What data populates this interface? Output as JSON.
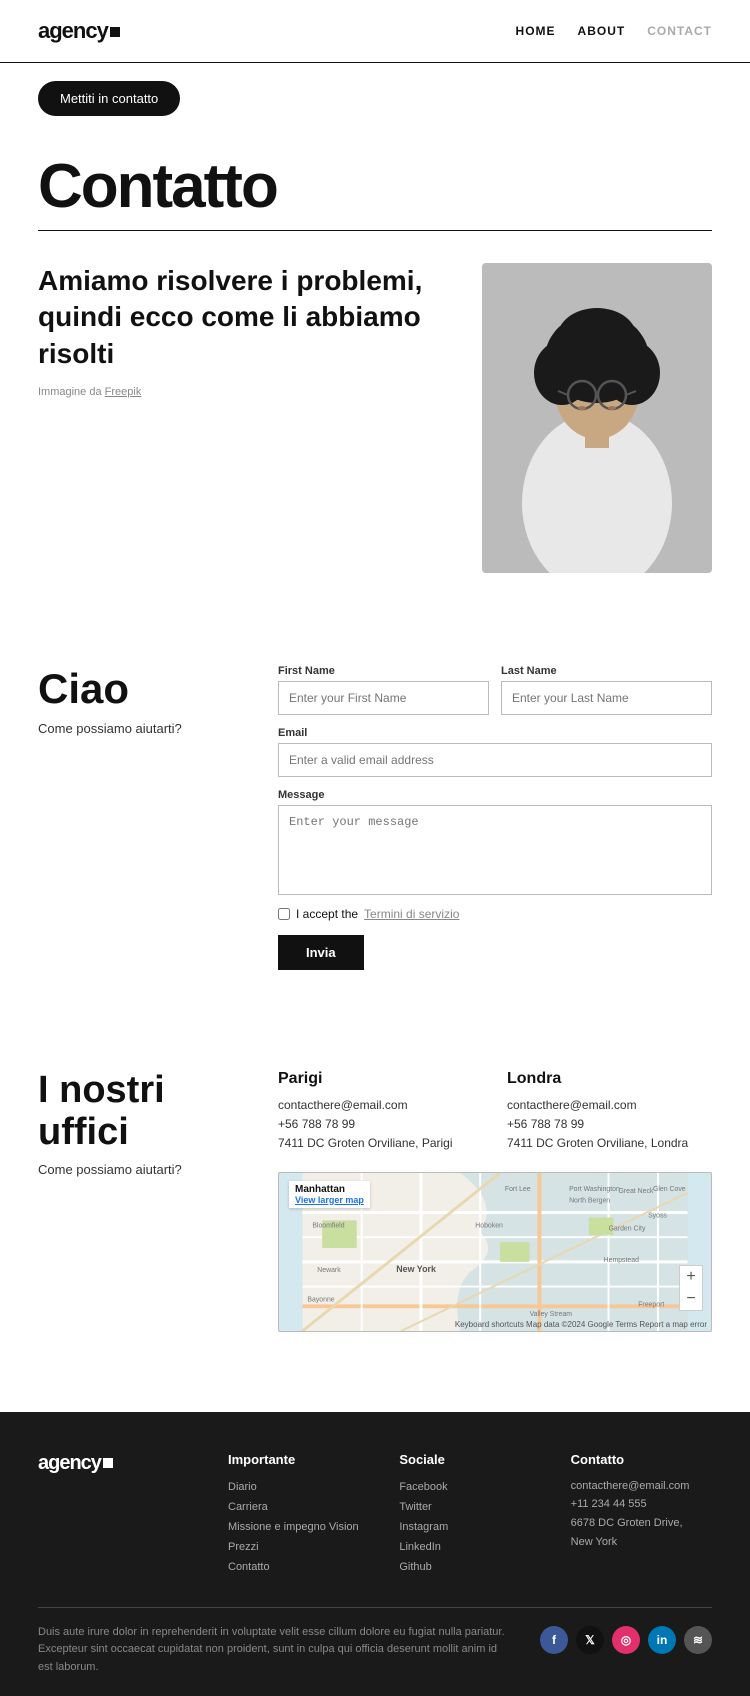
{
  "nav": {
    "logo": "agency",
    "links": [
      {
        "label": "HOME",
        "href": "#",
        "active": false
      },
      {
        "label": "ABOUT",
        "href": "#",
        "active": false
      },
      {
        "label": "CONTACT",
        "href": "#",
        "active": true
      }
    ]
  },
  "hero": {
    "cta_label": "Mettiti in contatto"
  },
  "contatto": {
    "heading": "Contatto"
  },
  "intro": {
    "heading": "Amiamo risolvere i problemi, quindi ecco come li abbiamo risolti",
    "image_credit": "Immagine da",
    "image_credit_link": "Freepik"
  },
  "form_section": {
    "left_heading": "Ciao",
    "left_sub": "Come possiamo aiutarti?",
    "first_name_label": "First Name",
    "first_name_placeholder": "Enter your First Name",
    "last_name_label": "Last Name",
    "last_name_placeholder": "Enter your Last Name",
    "email_label": "Email",
    "email_placeholder": "Enter a valid email address",
    "message_label": "Message",
    "message_placeholder": "Enter your message",
    "checkbox_text": "I accept the",
    "terms_link": "Termini di servizio",
    "submit_label": "Invia"
  },
  "uffici_section": {
    "left_heading": "I nostri uffici",
    "left_sub": "Come possiamo aiutarti?",
    "offices": [
      {
        "city": "Parigi",
        "email": "contacthere@email.com",
        "phone": "+56 788 78 99",
        "address": "7411 DC Groten Orviliane, Parigi"
      },
      {
        "city": "Londra",
        "email": "contacthere@email.com",
        "phone": "+56 788 78 99",
        "address": "7411 DC Groten Orviliane, Londra"
      }
    ],
    "map": {
      "label": "Manhattan",
      "view_larger": "View larger map",
      "footer": "Keyboard shortcuts  Map data ©2024 Google  Terms  Report a map error"
    }
  },
  "footer": {
    "logo": "agency",
    "columns": [
      {
        "heading": "Importante",
        "links": [
          "Diario",
          "Carriera",
          "Missione e impegno Vision",
          "Prezzi",
          "Contatto"
        ]
      },
      {
        "heading": "Sociale",
        "links": [
          "Facebook",
          "Twitter",
          "Instagram",
          "LinkedIn",
          "Github"
        ]
      },
      {
        "heading": "Contatto",
        "lines": [
          "contacthere@email.com",
          "+11 234 44 555",
          "6678 DC Groten Drive,",
          "New York"
        ]
      }
    ],
    "tagline": "Duis aute irure dolor in reprehenderit in voluptate velit esse cillum dolore eu fugiat nulla pariatur. Excepteur sint occaecat cupidatat non proident, sunt in culpa qui officia deserunt mollit anim id est laborum.",
    "social_icons": [
      {
        "name": "facebook",
        "label": "f",
        "color": "#3b5998"
      },
      {
        "name": "twitter",
        "label": "𝕏",
        "color": "#000"
      },
      {
        "name": "instagram",
        "label": "◎",
        "color": "#e1306c"
      },
      {
        "name": "linkedin",
        "label": "in",
        "color": "#0077b5"
      },
      {
        "name": "other",
        "label": "~",
        "color": "#555"
      }
    ]
  }
}
